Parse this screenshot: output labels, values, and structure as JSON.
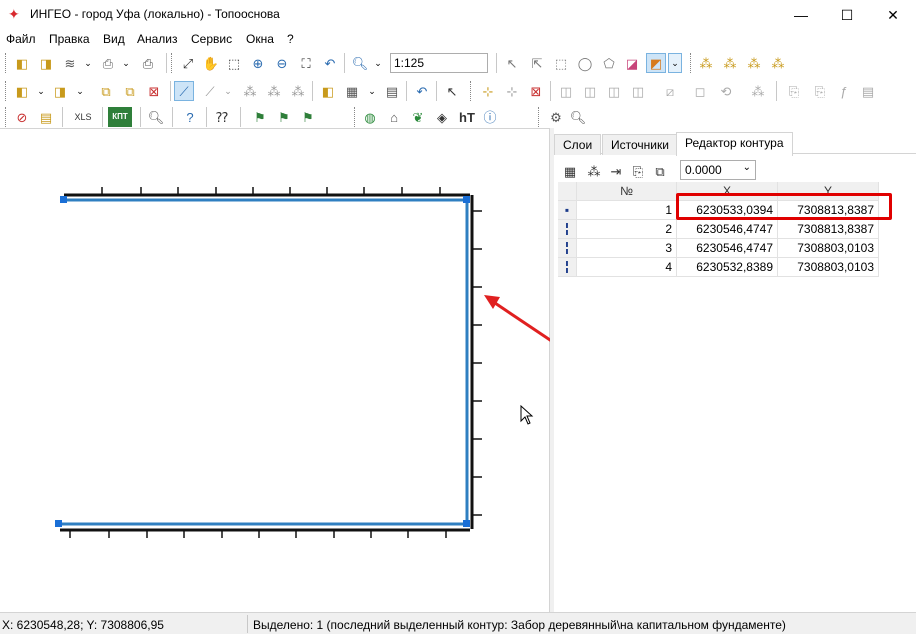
{
  "window": {
    "title": "ИНГЕО - город Уфа (локально) - Топооснова",
    "minimize": "—",
    "maximize": "☐",
    "close": "✕"
  },
  "menu": [
    "Файл",
    "Правка",
    "Вид",
    "Анализ",
    "Сервис",
    "Окна",
    "?"
  ],
  "toolbar": {
    "scale_value": "1:125",
    "xls_label": "XLS",
    "kpt_label": "КПТ",
    "ht_label": "hT"
  },
  "panel": {
    "tabs": [
      "Слои",
      "Источники",
      "Редактор контура"
    ],
    "active_tab": 2,
    "tolerance_value": "0.0000",
    "table": {
      "columns": [
        "№",
        "X",
        "Y"
      ],
      "rows": [
        {
          "n": "1",
          "x": "6230533,0394",
          "y": "7308813,8387",
          "marker": "▪"
        },
        {
          "n": "2",
          "x": "6230546,4747",
          "y": "7308813,8387",
          "marker": "╏"
        },
        {
          "n": "3",
          "x": "6230546,4747",
          "y": "7308803,0103",
          "marker": "╏"
        },
        {
          "n": "4",
          "x": "6230532,8389",
          "y": "7308803,0103",
          "marker": "╏"
        }
      ]
    }
  },
  "status": {
    "coords": "X: 6230548,28; Y: 7308806,95",
    "selection": "Выделено: 1 (последний выделенный контур: Забор деревянный\\на капитальном фундаменте)"
  },
  "colors": {
    "contour": "#2f7fc1",
    "annotation": "#e02020",
    "highlight": "#e00000"
  }
}
